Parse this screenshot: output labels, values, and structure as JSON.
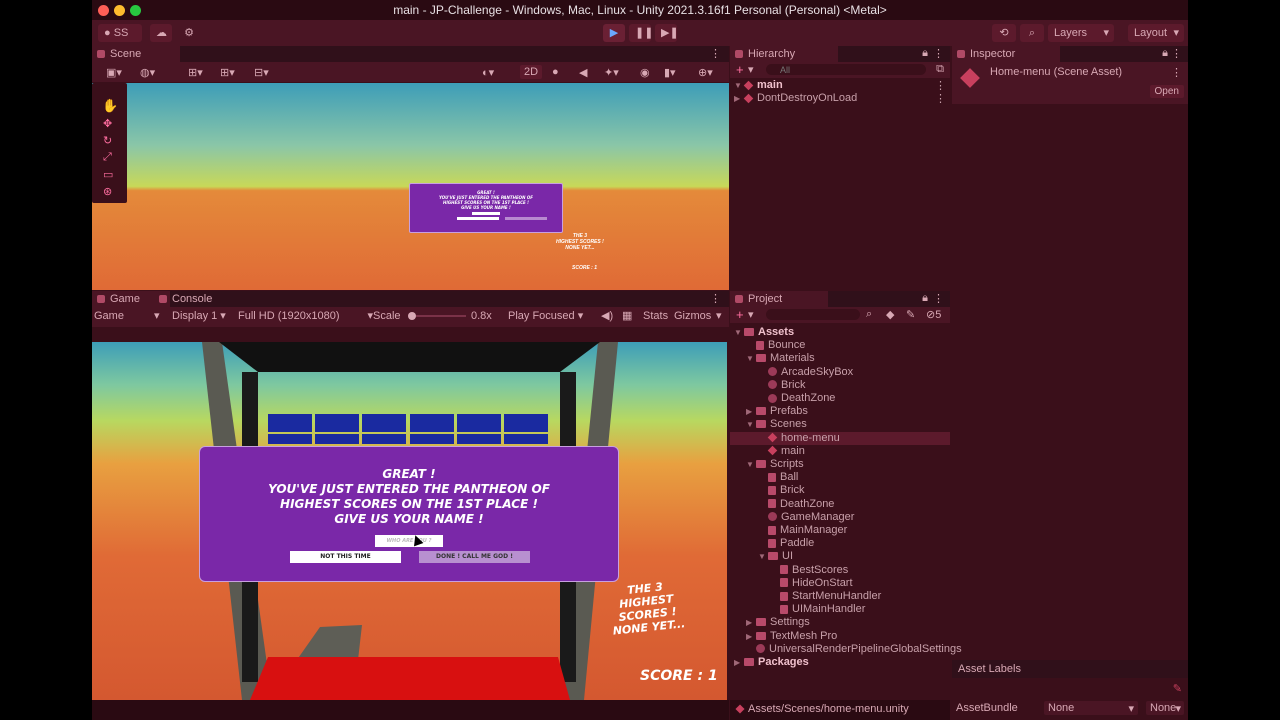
{
  "window": {
    "title": "main - JP-Challenge - Windows, Mac, Linux - Unity 2021.3.16f1 Personal (Personal) <Metal>"
  },
  "toolbar": {
    "account": "SS",
    "layers": "Layers",
    "layout": "Layout"
  },
  "scene": {
    "tab": "Scene",
    "mode2d": "2D",
    "panel_lines": [
      "GREAT !",
      "YOU'VE JUST ENTERED THE PANTHEON OF",
      "HIGHEST SCORES ON THE 1ST PLACE !",
      "GIVE US YOUR NAME !"
    ],
    "side_text": [
      "THE 3",
      "HIGHEST SCORES !",
      "NONE YET..."
    ],
    "score": "SCORE : 1"
  },
  "game": {
    "tab_game": "Game",
    "tab_console": "Console",
    "mode": "Game",
    "display": "Display 1",
    "resolution": "Full HD (1920x1080)",
    "scale_label": "Scale",
    "scale_value": "0.8x",
    "play_mode": "Play Focused",
    "stats": "Stats",
    "gizmos": "Gizmos",
    "panel": {
      "line1": "GREAT !",
      "line2": "YOU'VE JUST ENTERED THE PANTHEON OF",
      "line3": "HIGHEST SCORES ON THE 1ST PLACE !",
      "line4": "GIVE US YOUR NAME !",
      "input_placeholder": "WHO ARE YOU ?",
      "btn_no": "NOT THIS TIME",
      "btn_done": "DONE ! CALL ME GOD !"
    },
    "side": {
      "l1": "THE 3",
      "l2": "HIGHEST SCORES !",
      "l3": "NONE YET..."
    },
    "score": "SCORE : 1"
  },
  "hierarchy": {
    "tab": "Hierarchy",
    "search_placeholder": "All",
    "items": [
      "main",
      "DontDestroyOnLoad"
    ]
  },
  "inspector": {
    "tab": "Inspector",
    "asset_title": "Home-menu (Scene Asset)",
    "open": "Open",
    "asset_labels": "Asset Labels",
    "asset_bundle": "AssetBundle",
    "bundle_value": "None",
    "variant_value": "None"
  },
  "project": {
    "tab": "Project",
    "hidden_count": "5",
    "tree": [
      {
        "label": "Assets",
        "depth": 0,
        "kind": "folder",
        "arrow": "▼"
      },
      {
        "label": "Bounce",
        "depth": 1,
        "kind": "file",
        "arrow": ""
      },
      {
        "label": "Materials",
        "depth": 1,
        "kind": "folder",
        "arrow": "▼"
      },
      {
        "label": "ArcadeSkyBox",
        "depth": 2,
        "kind": "circle",
        "arrow": ""
      },
      {
        "label": "Brick",
        "depth": 2,
        "kind": "circle",
        "arrow": ""
      },
      {
        "label": "DeathZone",
        "depth": 2,
        "kind": "circle",
        "arrow": ""
      },
      {
        "label": "Prefabs",
        "depth": 1,
        "kind": "folder",
        "arrow": "▶"
      },
      {
        "label": "Scenes",
        "depth": 1,
        "kind": "folder",
        "arrow": "▼"
      },
      {
        "label": "home-menu",
        "depth": 2,
        "kind": "unity",
        "arrow": "",
        "selected": true
      },
      {
        "label": "main",
        "depth": 2,
        "kind": "unity",
        "arrow": ""
      },
      {
        "label": "Scripts",
        "depth": 1,
        "kind": "folder",
        "arrow": "▼"
      },
      {
        "label": "Ball",
        "depth": 2,
        "kind": "script",
        "arrow": ""
      },
      {
        "label": "Brick",
        "depth": 2,
        "kind": "script",
        "arrow": ""
      },
      {
        "label": "DeathZone",
        "depth": 2,
        "kind": "script",
        "arrow": ""
      },
      {
        "label": "GameManager",
        "depth": 2,
        "kind": "circle",
        "arrow": ""
      },
      {
        "label": "MainManager",
        "depth": 2,
        "kind": "script",
        "arrow": ""
      },
      {
        "label": "Paddle",
        "depth": 2,
        "kind": "script",
        "arrow": ""
      },
      {
        "label": "UI",
        "depth": 2,
        "kind": "folder",
        "arrow": "▼"
      },
      {
        "label": "BestScores",
        "depth": 3,
        "kind": "script",
        "arrow": ""
      },
      {
        "label": "HideOnStart",
        "depth": 3,
        "kind": "script",
        "arrow": ""
      },
      {
        "label": "StartMenuHandler",
        "depth": 3,
        "kind": "script",
        "arrow": ""
      },
      {
        "label": "UIMainHandler",
        "depth": 3,
        "kind": "script",
        "arrow": ""
      },
      {
        "label": "Settings",
        "depth": 1,
        "kind": "folder",
        "arrow": "▶"
      },
      {
        "label": "TextMesh Pro",
        "depth": 1,
        "kind": "folder",
        "arrow": "▶"
      },
      {
        "label": "UniversalRenderPipelineGlobalSettings",
        "depth": 1,
        "kind": "circle",
        "arrow": ""
      },
      {
        "label": "Packages",
        "depth": 0,
        "kind": "folder",
        "arrow": "▶"
      }
    ],
    "path": "Assets/Scenes/home-menu.unity"
  },
  "colors": {
    "accent": "#b04a66",
    "panel_purple": "#7a28a8"
  }
}
